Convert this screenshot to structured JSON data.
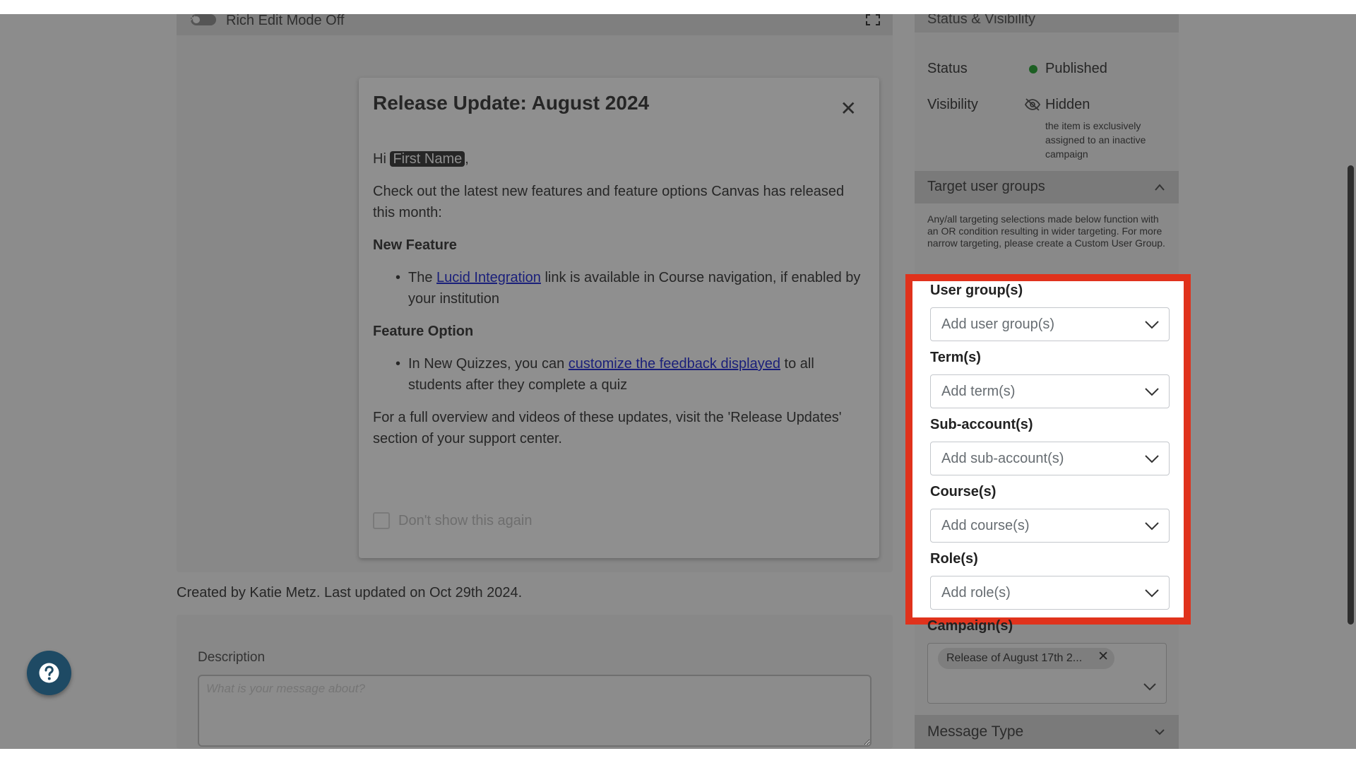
{
  "editor": {
    "rich_edit_label": "Rich Edit Mode Off",
    "toggle_symbol": "✕"
  },
  "modal": {
    "title": "Release Update: August 2024",
    "close_symbol": "✕",
    "greeting_prefix": "Hi ",
    "greeting_name": "First Name",
    "greeting_suffix": ",",
    "intro": "Check out the latest new features and feature options Canvas has released this month:",
    "new_feature_heading": "New Feature",
    "nf_prefix": "The ",
    "nf_link": "Lucid Integration",
    "nf_suffix": " link is available in Course navigation, if enabled by your institution",
    "feature_option_heading": "Feature Option",
    "fo_prefix": "In New Quizzes, you can ",
    "fo_link": "customize the feedback displayed",
    "fo_suffix": " to all students after they complete a quiz",
    "outro": "For a full overview and videos of these updates, visit the 'Release Updates' section of your support center.",
    "dont_show_label": "Don't show this again"
  },
  "created_by": "Created by Katie Metz. Last updated on Oct 29th 2024.",
  "description": {
    "label": "Description",
    "placeholder": "What is your message about?"
  },
  "sidebar": {
    "status_visibility_heading": "Status & Visibility",
    "status_label": "Status",
    "status_value": "Published",
    "visibility_label": "Visibility",
    "visibility_value": "Hidden",
    "visibility_note": "the item is exclusively assigned to an inactive campaign",
    "target_heading": "Target user groups",
    "target_note": "Any/all targeting selections made below function with an OR condition resulting in wider targeting. For more narrow targeting, please create a Custom User Group.",
    "fields": [
      {
        "label": "User group(s)",
        "placeholder": "Add user group(s)"
      },
      {
        "label": "Term(s)",
        "placeholder": "Add term(s)"
      },
      {
        "label": "Sub-account(s)",
        "placeholder": "Add sub-account(s)"
      },
      {
        "label": "Course(s)",
        "placeholder": "Add course(s)"
      },
      {
        "label": "Role(s)",
        "placeholder": "Add role(s)"
      }
    ],
    "campaigns_label": "Campaign(s)",
    "campaign_chip": "Release of August 17th 2...",
    "chip_remove_symbol": "✕",
    "message_type_heading": "Message Type"
  },
  "colors": {
    "overlay_bg": "#8c8c8c",
    "highlight_border": "#e0321c",
    "help_button": "#1e4a64",
    "status_dot": "#1c5f23"
  },
  "icons": [
    "expand-icon",
    "close-icon",
    "eye-slash-icon",
    "chevron-up-icon",
    "chevron-down-icon",
    "question-icon"
  ]
}
